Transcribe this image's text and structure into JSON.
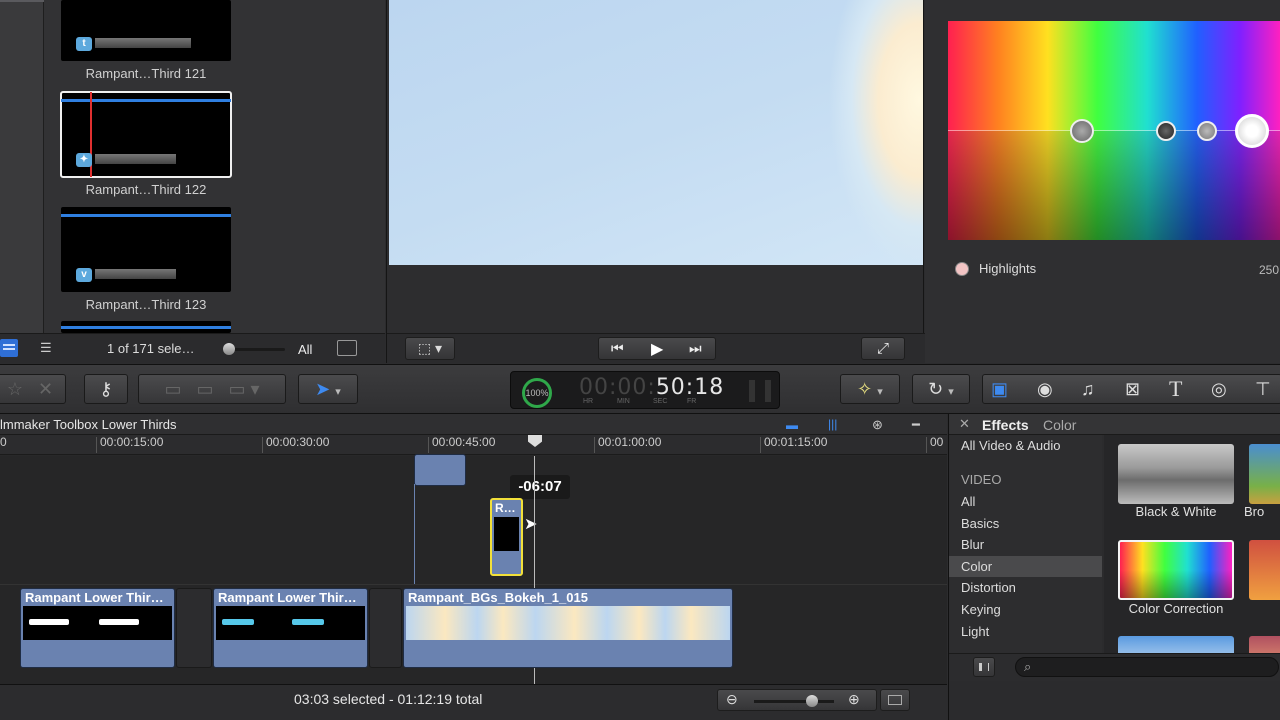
{
  "browser": {
    "clips": [
      {
        "label": "Rampant…Third 121",
        "icon": "t"
      },
      {
        "label": "Rampant…Third 122",
        "icon": "bird"
      },
      {
        "label": "Rampant…Third 123",
        "icon": "v"
      }
    ],
    "selection_count": "1 of 171 sele…",
    "filter": "All"
  },
  "viewer": {},
  "inspector": {
    "highlights_label": "Highlights",
    "highlights_value": "250"
  },
  "toolbar": {
    "timecode": {
      "percent": "100",
      "percent_unit": "%",
      "dim_part": "00:00:",
      "bright_part": "50:18",
      "labels": [
        "HR",
        "MIN",
        "SEC",
        "FR"
      ]
    }
  },
  "timeline": {
    "title": "lmmaker Toolbox Lower Thirds",
    "ruler_ticks": [
      "0",
      "00:00:15:00",
      "00:00:30:00",
      "00:00:45:00",
      "00:01:00:00",
      "00:01:15:00",
      "00"
    ],
    "drag_tooltip": "-06:07",
    "dragged_clip_label": "R…",
    "clips": [
      {
        "name": "Rampant Lower Thir…"
      },
      {
        "name": "Rampant Lower Thir…"
      },
      {
        "name": "Rampant_BGs_Bokeh_1_015"
      }
    ],
    "status": "03:03 selected - 01:12:19 total"
  },
  "effects": {
    "title": "Effects",
    "subtitle": "Color",
    "all_label": "All Video & Audio",
    "section": "VIDEO",
    "categories": [
      "All",
      "Basics",
      "Blur",
      "Color",
      "Distortion",
      "Keying",
      "Light"
    ],
    "selected_category": "Color",
    "thumbs": [
      {
        "label": "Black & White"
      },
      {
        "label": "Bro"
      },
      {
        "label": "Color Correction"
      }
    ]
  },
  "colors": {
    "accent": "#2f7fe0",
    "clip": "#6a82b0",
    "timecode_ring": "#2fa84a",
    "selection_yellow": "#f2e03a"
  }
}
